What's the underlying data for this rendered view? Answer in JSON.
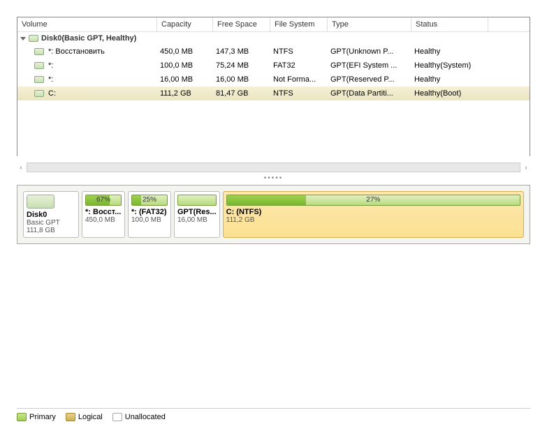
{
  "columns": {
    "volume": "Volume",
    "capacity": "Capacity",
    "free": "Free Space",
    "fs": "File System",
    "type": "Type",
    "status": "Status"
  },
  "disk": {
    "header": "Disk0(Basic GPT, Healthy)",
    "name": "Disk0",
    "scheme": "Basic GPT",
    "size": "111,8 GB"
  },
  "partitions": [
    {
      "volume": "*: Восстановить",
      "capacity": "450,0 MB",
      "free": "147,3 MB",
      "fs": "NTFS",
      "type": "GPT(Unknown P...",
      "status": "Healthy",
      "pct": "67%",
      "pctval": 67,
      "mapname": "*: Восст...",
      "mapsize": "450,0 MB"
    },
    {
      "volume": "*:",
      "capacity": "100,0 MB",
      "free": "75,24 MB",
      "fs": "FAT32",
      "type": "GPT(EFI System ...",
      "status": "Healthy(System)",
      "pct": "25%",
      "pctval": 25,
      "mapname": "*: (FAT32)",
      "mapsize": "100,0 MB"
    },
    {
      "volume": "*:",
      "capacity": "16,00 MB",
      "free": "16,00 MB",
      "fs": "Not Forma...",
      "type": "GPT(Reserved P...",
      "status": "Healthy",
      "pct": "",
      "pctval": 0,
      "mapname": "GPT(Res...",
      "mapsize": "16,00 MB"
    },
    {
      "volume": "C:",
      "capacity": "111,2 GB",
      "free": "81,47 GB",
      "fs": "NTFS",
      "type": "GPT(Data Partiti...",
      "status": "Healthy(Boot)",
      "pct": "27%",
      "pctval": 27,
      "mapname": "C: (NTFS)",
      "mapsize": "111,2 GB"
    }
  ],
  "legend": {
    "primary": "Primary",
    "logical": "Logical",
    "unallocated": "Unallocated"
  }
}
